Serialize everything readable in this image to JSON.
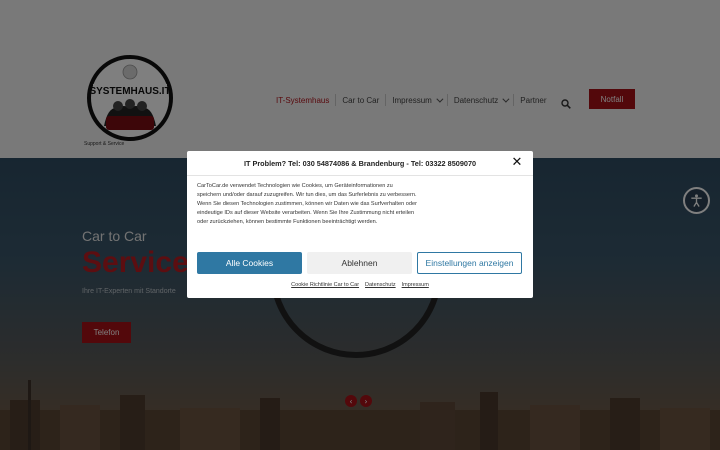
{
  "header": {
    "logo_text": "SYSTEMHAUS.IT",
    "tagline": "Support & Service",
    "nav": [
      {
        "label": "IT-Systemhaus",
        "active": true,
        "dropdown": false
      },
      {
        "label": "Car to Car",
        "active": false,
        "dropdown": false
      },
      {
        "label": "Impressum",
        "active": false,
        "dropdown": true
      },
      {
        "label": "Datenschutz",
        "active": false,
        "dropdown": true
      },
      {
        "label": "Partner",
        "active": false,
        "dropdown": false
      }
    ],
    "notfall_label": "Notfall"
  },
  "hero": {
    "subtitle": "Car to Car",
    "title": "Service",
    "description": "Ihre IT-Experten mit Standorte",
    "telefon_label": "Telefon",
    "prev_arrow": "‹",
    "next_arrow": "›"
  },
  "cookie_modal": {
    "title": "IT Problem? Tel: 030 54874086 & Brandenburg - Tel: 03322 8509070",
    "close_symbol": "✕",
    "text": "CarToCar.de verwendet Technologien wie Cookies, um Geräteinformationen zu speichern und/oder darauf zuzugreifen. Wir tun dies, um das Surferlebnis zu verbessern. Wenn Sie diesen Technologien zustimmen, können wir Daten wie das Surfverhalten oder eindeutige IDs auf dieser Website verarbeiten. Wenn Sie Ihre Zustimmung nicht erteilen oder zurückziehen, können bestimmte Funktionen beeinträchtigt werden.",
    "accept_label": "Alle Cookies",
    "deny_label": "Ablehnen",
    "prefs_label": "Einstellungen anzeigen",
    "links": {
      "cookie_policy": "Cookie Richtlinie Car to Car",
      "privacy": "Datenschutz",
      "imprint": "Impressum"
    }
  },
  "colors": {
    "brand_red": "#a71017",
    "accept_blue": "#2f78a3"
  },
  "icons": [
    "search-icon",
    "chevron-down-icon",
    "accessibility-icon",
    "close-icon",
    "arrow-left-icon",
    "arrow-right-icon"
  ]
}
